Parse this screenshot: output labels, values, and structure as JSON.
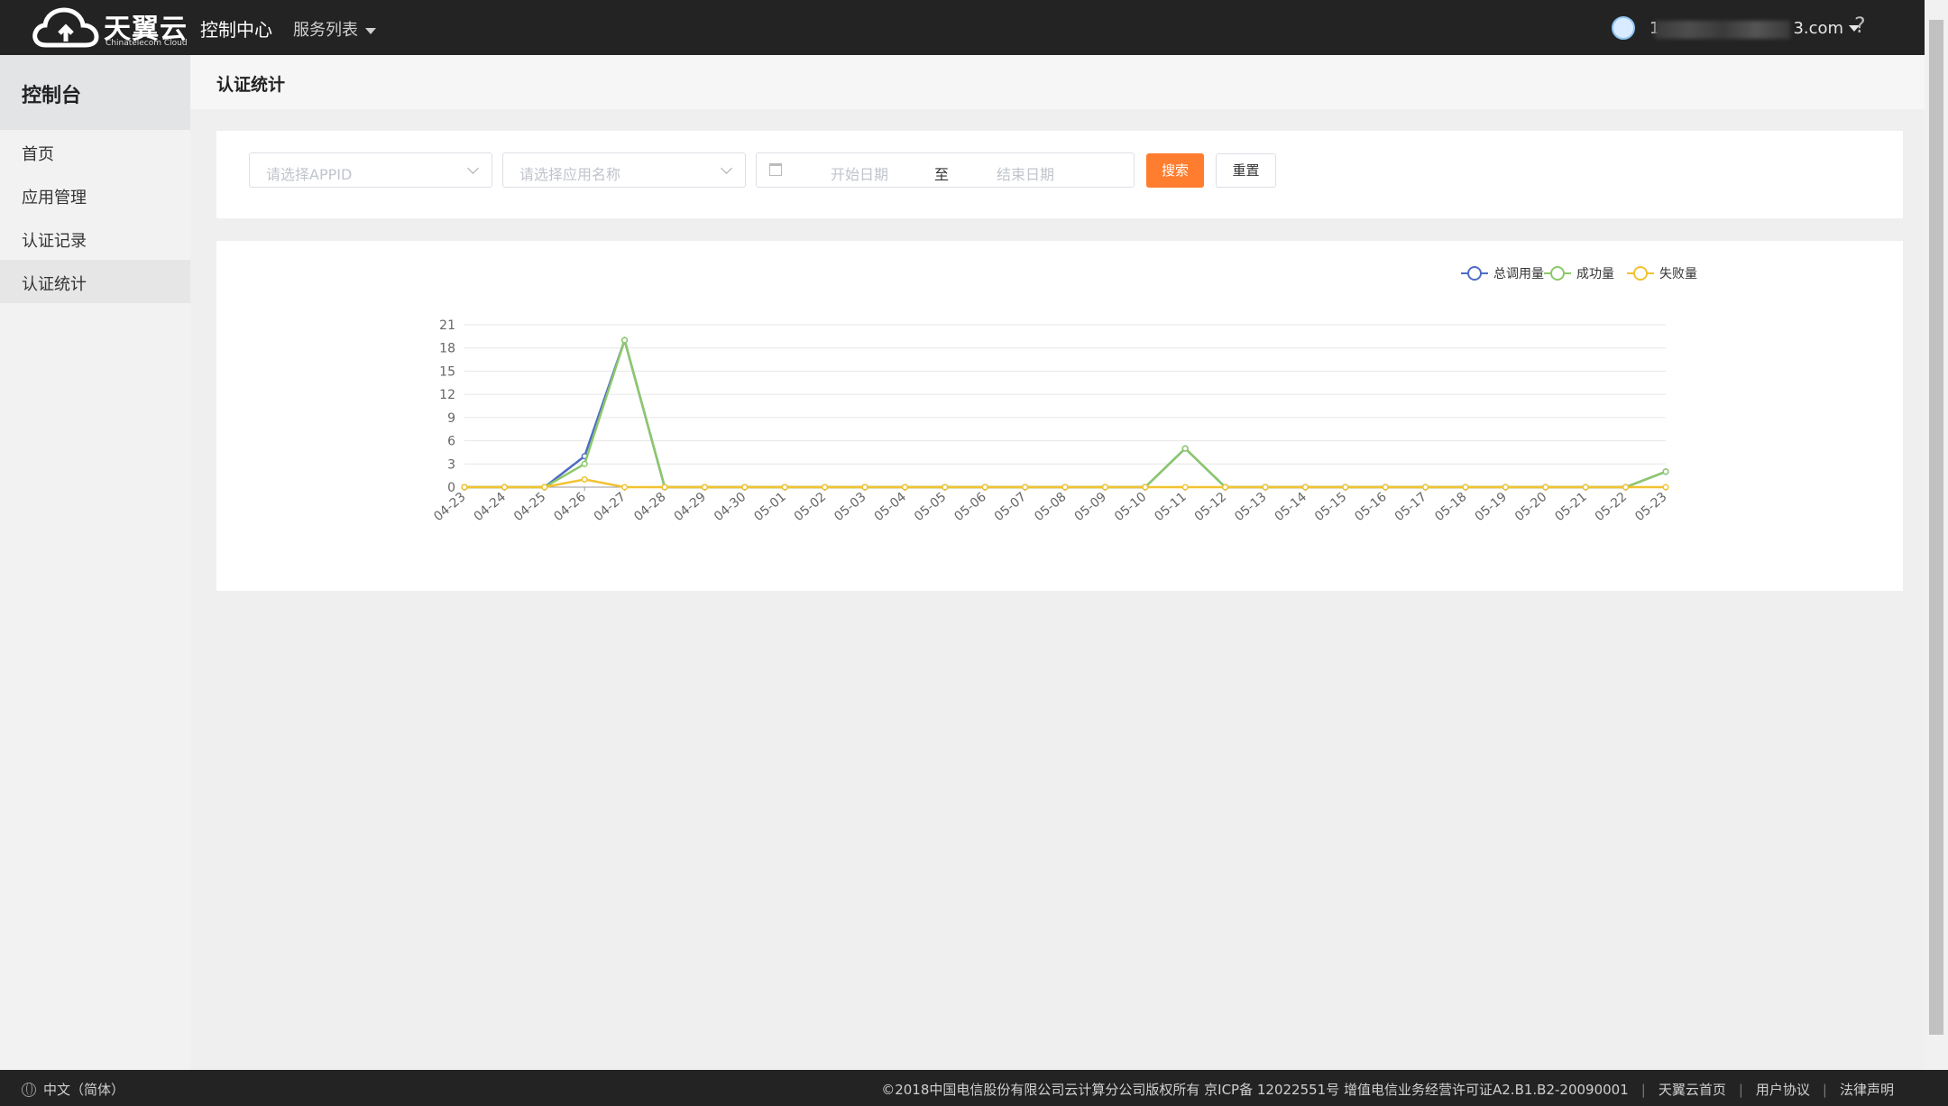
{
  "brand": {
    "name": "天翼云",
    "sub": "Chinatelecom Cloud"
  },
  "topbar": {
    "title": "控制中心",
    "services": "服务列表",
    "user_visible": "1",
    "user_suffix": "3.com",
    "help": "?"
  },
  "sidebar": {
    "title": "控制台",
    "items": [
      {
        "label": "首页",
        "active": false
      },
      {
        "label": "应用管理",
        "active": false
      },
      {
        "label": "认证记录",
        "active": false
      },
      {
        "label": "认证统计",
        "active": true
      }
    ]
  },
  "page": {
    "title": "认证统计"
  },
  "filters": {
    "appid_placeholder": "请选择APPID",
    "app_name_placeholder": "请选择应用名称",
    "start_date_placeholder": "开始日期",
    "separator": "至",
    "end_date_placeholder": "结束日期",
    "search_label": "搜索",
    "reset_label": "重置"
  },
  "chart_data": {
    "type": "line",
    "x": [
      "04-23",
      "04-24",
      "04-25",
      "04-26",
      "04-27",
      "04-28",
      "04-29",
      "04-30",
      "05-01",
      "05-02",
      "05-03",
      "05-04",
      "05-05",
      "05-06",
      "05-07",
      "05-08",
      "05-09",
      "05-10",
      "05-11",
      "05-12",
      "05-13",
      "05-14",
      "05-15",
      "05-16",
      "05-17",
      "05-18",
      "05-19",
      "05-20",
      "05-21",
      "05-22",
      "05-23"
    ],
    "ylim": [
      0,
      21
    ],
    "yticks": [
      0,
      3,
      6,
      9,
      12,
      15,
      18,
      21
    ],
    "legend_position": "top-right",
    "grid": true,
    "series": [
      {
        "name": "总调用量",
        "color": "#4f6bc7",
        "values": [
          0,
          0,
          0,
          4,
          19,
          0,
          0,
          0,
          0,
          0,
          0,
          0,
          0,
          0,
          0,
          0,
          0,
          0,
          5,
          0,
          0,
          0,
          0,
          0,
          0,
          0,
          0,
          0,
          0,
          0,
          2
        ]
      },
      {
        "name": "成功量",
        "color": "#8cc86a",
        "values": [
          0,
          0,
          0,
          3,
          19,
          0,
          0,
          0,
          0,
          0,
          0,
          0,
          0,
          0,
          0,
          0,
          0,
          0,
          5,
          0,
          0,
          0,
          0,
          0,
          0,
          0,
          0,
          0,
          0,
          0,
          2
        ]
      },
      {
        "name": "失败量",
        "color": "#f2c230",
        "values": [
          0,
          0,
          0,
          1,
          0,
          0,
          0,
          0,
          0,
          0,
          0,
          0,
          0,
          0,
          0,
          0,
          0,
          0,
          0,
          0,
          0,
          0,
          0,
          0,
          0,
          0,
          0,
          0,
          0,
          0,
          0
        ]
      }
    ]
  },
  "footer": {
    "language": "中文（简体）",
    "copyright": "©2018中国电信股份有限公司云计算分公司版权所有 京ICP备 12022551号 增值电信业务经营许可证A2.B1.B2-20090001",
    "links": [
      "天翼云首页",
      "用户协议",
      "法律声明"
    ]
  }
}
